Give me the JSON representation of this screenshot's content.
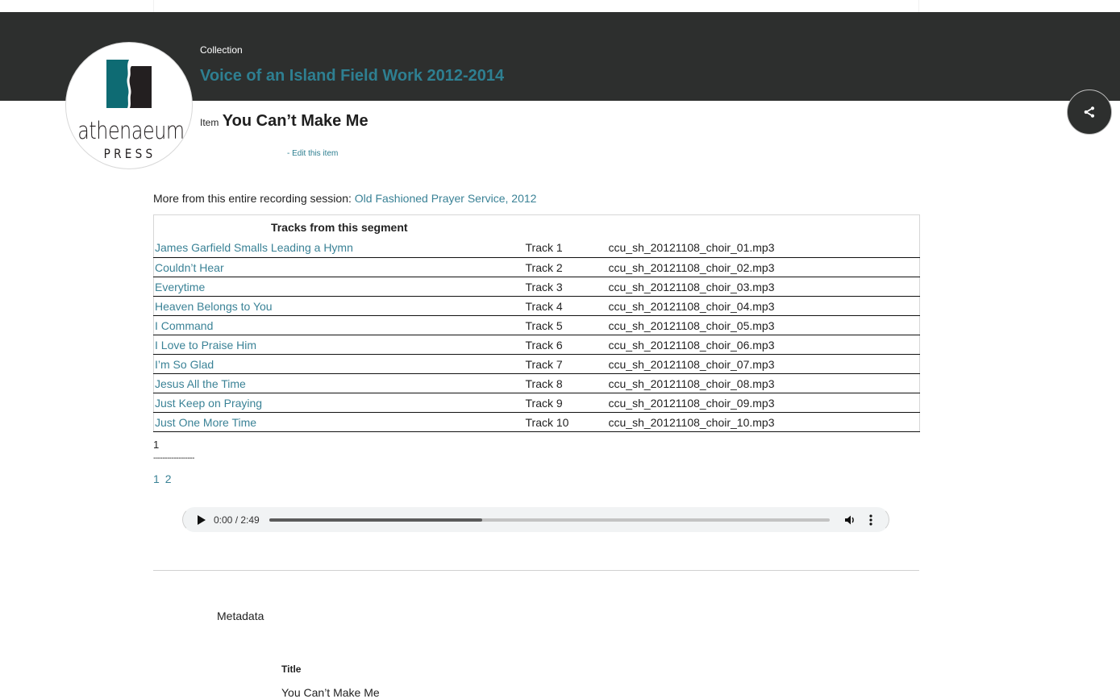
{
  "header": {
    "collection_label": "Collection",
    "collection_title": "Voice of an Island Field Work 2012-2014",
    "item_label": "Item",
    "item_title": "You Can’t Make Me",
    "edit_link": "- Edit this item",
    "logo": {
      "word": "athenaeum",
      "subword": "PRESS",
      "accent_color": "#0e6b73",
      "dark_color": "#231f20"
    },
    "share_icon": "share-icon"
  },
  "session": {
    "label": "More from this entire recording session:",
    "link": "Old Fashioned Prayer Service, 2012"
  },
  "tracks": {
    "heading": "Tracks from this segment",
    "rows": [
      {
        "title": "James Garfield Smalls Leading a Hymn",
        "track": "Track 1",
        "file": "ccu_sh_20121108_choir_01.mp3"
      },
      {
        "title": "Couldn’t Hear",
        "track": "Track 2",
        "file": "ccu_sh_20121108_choir_02.mp3"
      },
      {
        "title": "Everytime",
        "track": "Track 3",
        "file": "ccu_sh_20121108_choir_03.mp3"
      },
      {
        "title": "Heaven Belongs to You",
        "track": "Track 4",
        "file": "ccu_sh_20121108_choir_04.mp3"
      },
      {
        "title": "I Command",
        "track": "Track 5",
        "file": "ccu_sh_20121108_choir_05.mp3"
      },
      {
        "title": "I Love to Praise Him",
        "track": "Track 6",
        "file": "ccu_sh_20121108_choir_06.mp3"
      },
      {
        "title": "I’m So Glad",
        "track": "Track 7",
        "file": "ccu_sh_20121108_choir_07.mp3"
      },
      {
        "title": "Jesus All the Time",
        "track": "Track 8",
        "file": "ccu_sh_20121108_choir_08.mp3"
      },
      {
        "title": "Just Keep on Praying",
        "track": "Track 9",
        "file": "ccu_sh_20121108_choir_09.mp3"
      },
      {
        "title": "Just One More Time",
        "track": "Track 10",
        "file": "ccu_sh_20121108_choir_10.mp3"
      }
    ]
  },
  "pagination": {
    "current": "1",
    "separator": "------------------",
    "pages": [
      "1",
      "2"
    ]
  },
  "audio": {
    "time": "0:00 / 2:49",
    "buffered_fraction": 0.38,
    "play_icon": "play-icon",
    "volume_icon": "volume-icon",
    "more_icon": "more-vert-icon"
  },
  "metadata": {
    "heading": "Metadata",
    "fields": [
      {
        "label": "Title",
        "value": "You Can’t Make Me"
      }
    ]
  },
  "colors": {
    "header_bg": "#2d2f2e",
    "link": "#3a8296",
    "collection_title": "#2e7f91"
  }
}
